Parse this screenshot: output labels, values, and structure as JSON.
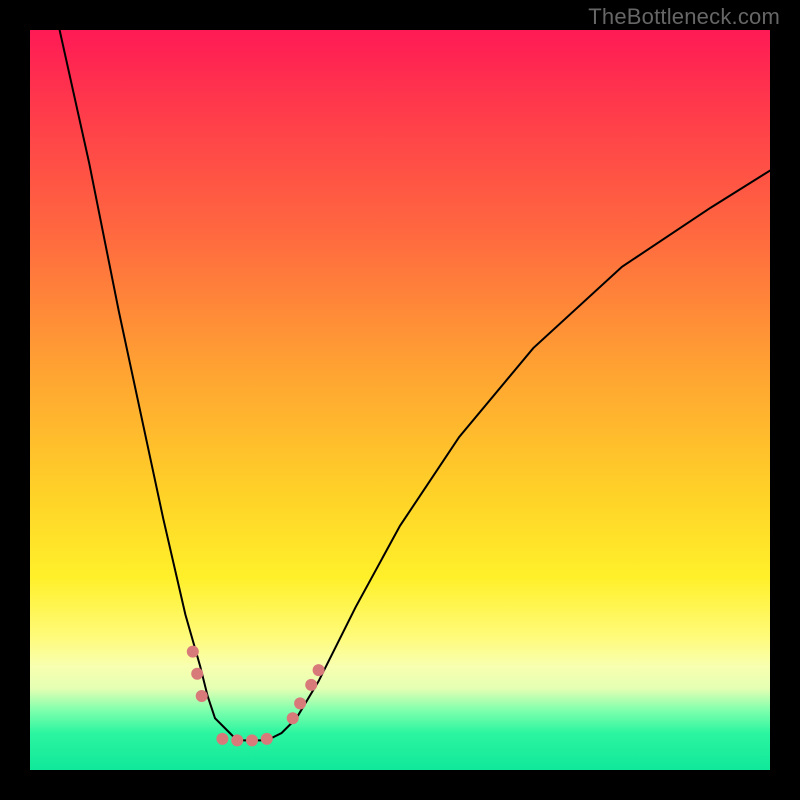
{
  "watermark": "TheBottleneck.com",
  "chart_data": {
    "type": "line",
    "title": "",
    "xlabel": "",
    "ylabel": "",
    "xlim": [
      0,
      100
    ],
    "ylim": [
      0,
      100
    ],
    "grid": false,
    "legend": false,
    "series": [
      {
        "name": "bottleneck-curve",
        "x": [
          4,
          8,
          12,
          15,
          18,
          21,
          23,
          24,
          25,
          27,
          28,
          30,
          32,
          34,
          36,
          39,
          44,
          50,
          58,
          68,
          80,
          92,
          100
        ],
        "y": [
          100,
          82,
          62,
          48,
          34,
          21,
          14,
          10,
          7,
          5,
          4,
          4,
          4,
          5,
          7,
          12,
          22,
          33,
          45,
          57,
          68,
          76,
          81
        ],
        "color": "#000000",
        "stroke_width": 2
      }
    ],
    "markers": [
      {
        "name": "threshold-dot",
        "x": 22.0,
        "y": 16,
        "color": "#d97a7a",
        "r": 6
      },
      {
        "name": "threshold-dot",
        "x": 22.6,
        "y": 13,
        "color": "#d97a7a",
        "r": 6
      },
      {
        "name": "threshold-dot",
        "x": 23.2,
        "y": 10,
        "color": "#d97a7a",
        "r": 6
      },
      {
        "name": "threshold-dot",
        "x": 26.0,
        "y": 4.2,
        "color": "#d97a7a",
        "r": 6
      },
      {
        "name": "threshold-dot",
        "x": 28.0,
        "y": 4.0,
        "color": "#d97a7a",
        "r": 6
      },
      {
        "name": "threshold-dot",
        "x": 30.0,
        "y": 4.0,
        "color": "#d97a7a",
        "r": 6
      },
      {
        "name": "threshold-dot",
        "x": 32.0,
        "y": 4.2,
        "color": "#d97a7a",
        "r": 6
      },
      {
        "name": "threshold-dot",
        "x": 35.5,
        "y": 7,
        "color": "#d97a7a",
        "r": 6
      },
      {
        "name": "threshold-dot",
        "x": 36.5,
        "y": 9,
        "color": "#d97a7a",
        "r": 6
      },
      {
        "name": "threshold-dot",
        "x": 38.0,
        "y": 11.5,
        "color": "#d97a7a",
        "r": 6
      },
      {
        "name": "threshold-dot",
        "x": 39.0,
        "y": 13.5,
        "color": "#d97a7a",
        "r": 6
      }
    ],
    "background_gradient_stops": [
      {
        "pos": 0.0,
        "color": "#ff1a55"
      },
      {
        "pos": 0.28,
        "color": "#ff6a3f"
      },
      {
        "pos": 0.62,
        "color": "#ffd028"
      },
      {
        "pos": 0.82,
        "color": "#fffb7a"
      },
      {
        "pos": 0.92,
        "color": "#7dffad"
      },
      {
        "pos": 1.0,
        "color": "#10e89a"
      }
    ]
  }
}
